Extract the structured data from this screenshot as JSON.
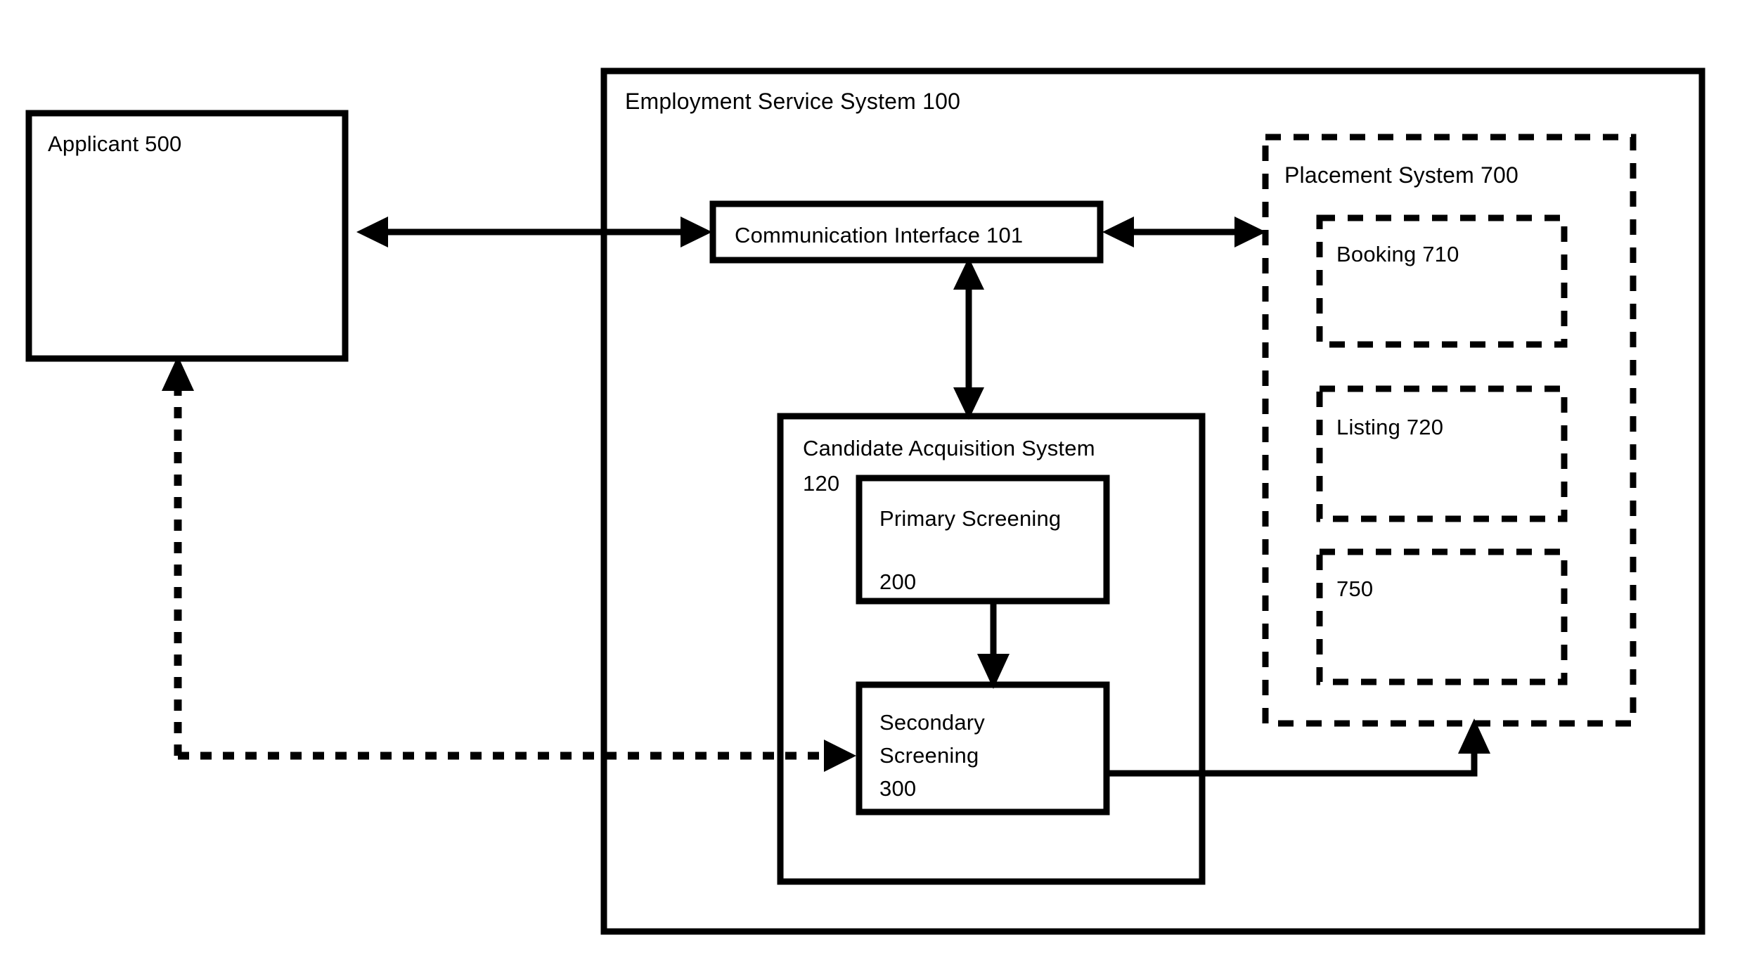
{
  "figure": {
    "type": "block-diagram",
    "background_color": "#ffffff",
    "line_color": "#000000"
  },
  "blocks": {
    "applicant": {
      "label": "Applicant 500",
      "name": "Applicant",
      "number": "500",
      "border": "solid"
    },
    "employment_service_system": {
      "label": "Employment Service System 100",
      "name": "Employment Service System",
      "number": "100",
      "border": "solid"
    },
    "communication_interface": {
      "label": "Communication Interface   101",
      "name": "Communication Interface",
      "number": "101",
      "border": "solid"
    },
    "candidate_acquisition_system": {
      "label_line1": "Candidate Acquisition System",
      "label_line2": "120",
      "name": "Candidate Acquisition System",
      "number": "120",
      "border": "solid"
    },
    "primary_screening": {
      "label_line1": "Primary Screening",
      "label_line2": "200",
      "name": "Primary Screening",
      "number": "200",
      "border": "solid"
    },
    "secondary_screening": {
      "label_line1": "Secondary",
      "label_line2": "Screening",
      "label_line3": "300",
      "name": "Secondary Screening",
      "number": "300",
      "border": "solid"
    },
    "placement_system": {
      "label": "Placement System 700",
      "name": "Placement System",
      "number": "700",
      "border": "dashed"
    },
    "booking": {
      "label": "Booking   710",
      "name": "Booking",
      "number": "710",
      "border": "dashed"
    },
    "listing": {
      "label": "Listing   720",
      "name": "Listing",
      "number": "720",
      "border": "dashed"
    },
    "unit_750": {
      "label": "750",
      "name": "",
      "number": "750",
      "border": "dashed"
    }
  },
  "connectors": [
    {
      "id": "applicant-communication-interface",
      "from": "Applicant 500",
      "to": "Communication Interface 101",
      "style": "solid",
      "arrows": "bidirectional"
    },
    {
      "id": "communication-interface-placement-system",
      "from": "Communication Interface 101",
      "to": "Placement System 700",
      "style": "solid",
      "arrows": "bidirectional"
    },
    {
      "id": "communication-interface-candidate-acquisition-system",
      "from": "Communication Interface 101",
      "to": "Candidate Acquisition System 120",
      "style": "solid",
      "arrows": "bidirectional"
    },
    {
      "id": "primary-screening-secondary-screening",
      "from": "Primary Screening 200",
      "to": "Secondary Screening 300",
      "style": "solid",
      "arrows": "forward"
    },
    {
      "id": "secondary-screening-placement-system",
      "from": "Secondary Screening 300",
      "to": "Placement System 700",
      "style": "solid",
      "arrows": "forward"
    },
    {
      "id": "applicant-secondary-screening-feedback",
      "from": "Applicant 500",
      "to": "Secondary Screening 300",
      "style": "dashed",
      "arrows": "bidirectional-split"
    }
  ]
}
